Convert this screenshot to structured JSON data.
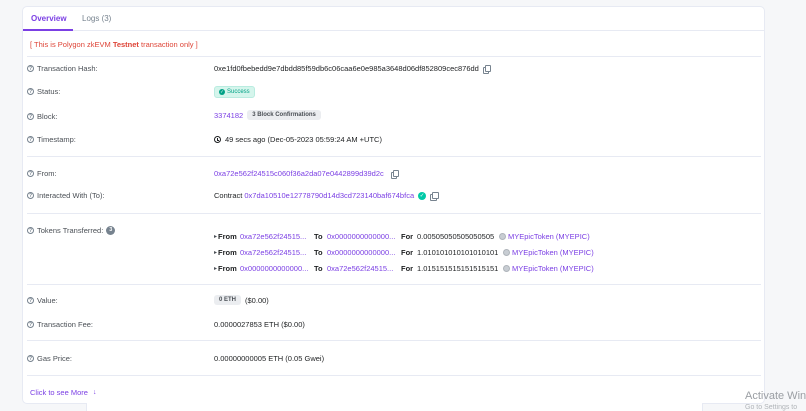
{
  "tabs": [
    {
      "label": "Overview"
    },
    {
      "label": "Logs (3)"
    }
  ],
  "notice": {
    "prefix": "[ This is Polygon zkEVM ",
    "bold": "Testnet",
    "suffix": " transaction only ]"
  },
  "fields": {
    "tx_hash": {
      "label": "Transaction Hash:",
      "value": "0xe1fd0fbebedd9e7dbdd85f59db6c06caa6e0e985a3648d06df852809cec876dd"
    },
    "status": {
      "label": "Status:",
      "value": "Success"
    },
    "block": {
      "label": "Block:",
      "value": "3374182",
      "confirmations": "3 Block Confirmations"
    },
    "timestamp": {
      "label": "Timestamp:",
      "value": "49 secs ago (Dec-05-2023 05:59:24 AM +UTC)"
    },
    "from": {
      "label": "From:",
      "value": "0xa72e562f24515c060f36a2da07e0442899d39d2c"
    },
    "interacted": {
      "label": "Interacted With (To):",
      "prefix": "Contract",
      "value": "0x7da10510e12778790d14d3cd723140baf674bfca"
    },
    "tokens": {
      "label": "Tokens Transferred:",
      "count": "3"
    },
    "value": {
      "label": "Value:",
      "badge": "0 ETH",
      "usd": "($0.00)"
    },
    "fee": {
      "label": "Transaction Fee:",
      "value": "0.0000027853 ETH ($0.00)"
    },
    "gas": {
      "label": "Gas Price:",
      "value": "0.00000000005 ETH (0.05 Gwei)"
    }
  },
  "transfers": [
    {
      "from_label": "From",
      "from": "0xa72e562f24515...",
      "to_label": "To",
      "to": "0x0000000000000...",
      "for_label": "For",
      "amount": "0.00505050505050505",
      "token": "MYEpicToken (MYEPIC)"
    },
    {
      "from_label": "From",
      "from": "0xa72e562f24515...",
      "to_label": "To",
      "to": "0x0000000000000...",
      "for_label": "For",
      "amount": "1.010101010101010101",
      "token": "MYEpicToken (MYEPIC)"
    },
    {
      "from_label": "From",
      "from": "0x0000000000000...",
      "to_label": "To",
      "to": "0xa72e562f24515...",
      "for_label": "For",
      "amount": "1.015151515151515151",
      "token": "MYEpicToken (MYEPIC)"
    }
  ],
  "more": {
    "label": "Click to see More"
  },
  "watermark": {
    "title": "Activate Wind",
    "sub": "Go to Settings to"
  },
  "colors": {
    "accent": "#7b3fe4",
    "success": "#00a186",
    "danger": "#de4437"
  }
}
